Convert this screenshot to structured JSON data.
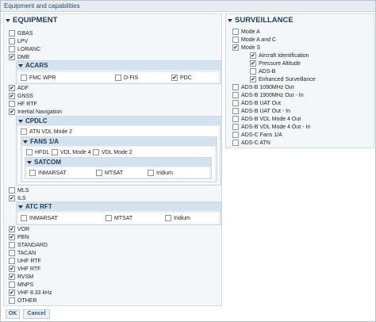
{
  "title": "Equipment and capabilities",
  "equipment": {
    "header": "EQUIPMENT",
    "items_top": [
      {
        "label": "GBAS",
        "checked": false
      },
      {
        "label": "LPV",
        "checked": false
      },
      {
        "label": "LORANC",
        "checked": false
      },
      {
        "label": "DME",
        "checked": true
      }
    ],
    "acars": {
      "header": "ACARS",
      "items": [
        {
          "label": "FMC WPR",
          "checked": false
        },
        {
          "label": "D-FIS",
          "checked": false
        },
        {
          "label": "PDC",
          "checked": true
        }
      ]
    },
    "items_mid": [
      {
        "label": "ADF",
        "checked": true
      },
      {
        "label": "GNSS",
        "checked": true
      },
      {
        "label": "HF RTF",
        "checked": false
      },
      {
        "label": "Inertial Navigation",
        "checked": true
      }
    ],
    "cpdlc": {
      "header": "CPDLC",
      "atn": {
        "label": "ATN VDL Mode 2",
        "checked": false
      },
      "fans": {
        "header": "FANS 1/A",
        "items": [
          {
            "label": "HFDL",
            "checked": false
          },
          {
            "label": "VDL Mode 4",
            "checked": false
          },
          {
            "label": "VDL Mode 2",
            "checked": false
          }
        ],
        "satcom": {
          "header": "SATCOM",
          "items": [
            {
              "label": "INMARSAT",
              "checked": false
            },
            {
              "label": "MTSAT",
              "checked": false
            },
            {
              "label": "Iridium",
              "checked": false
            }
          ]
        }
      }
    },
    "items_mls": [
      {
        "label": "MLS",
        "checked": false
      },
      {
        "label": "ILS",
        "checked": true
      }
    ],
    "atc_rft": {
      "header": "ATC RFT",
      "items": [
        {
          "label": "INMARSAT",
          "checked": false
        },
        {
          "label": "MTSAT",
          "checked": false
        },
        {
          "label": "Iridium",
          "checked": false
        }
      ]
    },
    "items_bottom": [
      {
        "label": "VOR",
        "checked": true
      },
      {
        "label": "PBN",
        "checked": true
      },
      {
        "label": "STANDARD",
        "checked": false
      },
      {
        "label": "TACAN",
        "checked": false
      },
      {
        "label": "UHF RTF",
        "checked": false
      },
      {
        "label": "VHF RTF",
        "checked": true
      },
      {
        "label": "RVSM",
        "checked": true
      },
      {
        "label": "MNPS",
        "checked": false
      },
      {
        "label": "VHF 8.33 kHz",
        "checked": true
      },
      {
        "label": "OTHER",
        "checked": false
      }
    ]
  },
  "surveillance": {
    "header": "SURVEILLANCE",
    "items_top": [
      {
        "label": "Mode A",
        "checked": false
      },
      {
        "label": "Mode A and C",
        "checked": false
      },
      {
        "label": "Mode S",
        "checked": true
      }
    ],
    "mode_s_items": [
      {
        "label": "Aircraft Identification",
        "checked": true
      },
      {
        "label": "Pressure Altitude",
        "checked": true
      },
      {
        "label": "ADS-B",
        "checked": false
      },
      {
        "label": "Enhanced Surveillance",
        "checked": true
      }
    ],
    "items_bottom": [
      {
        "label": "ADS-B 1090MHz Out",
        "checked": false
      },
      {
        "label": "ADS-B 1900MHz Out - In",
        "checked": false
      },
      {
        "label": "ADS-B UAT Out",
        "checked": false
      },
      {
        "label": "ADS-B UAT Out - In",
        "checked": false
      },
      {
        "label": "ADS-B VDL Mode 4 Out",
        "checked": false
      },
      {
        "label": "ADS-B VDL Mode 4 Out - In",
        "checked": false
      },
      {
        "label": "ADS-C Fans 1/A",
        "checked": false
      },
      {
        "label": "ADS-C ATN",
        "checked": false
      }
    ]
  },
  "buttons": {
    "ok": "OK",
    "cancel": "Cancel"
  }
}
